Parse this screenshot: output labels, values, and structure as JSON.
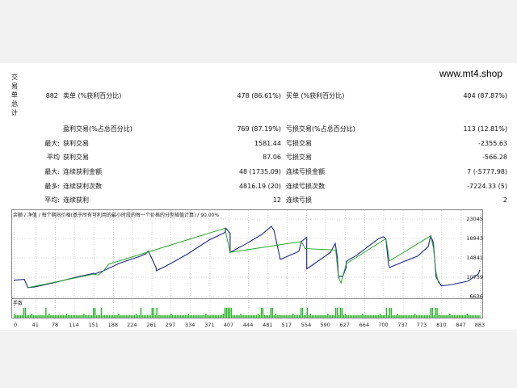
{
  "site": "www.mt4.shop",
  "side_label": [
    "交",
    "易",
    "单",
    "总",
    "计"
  ],
  "stats": {
    "total": "882",
    "short_label": "卖单 (%获利百分比)",
    "short_value": "478 (86.61%)",
    "long_label": "买单 (%获利百分比)",
    "long_value": "404 (87.87%)",
    "profit_trades_label": "盈利交易(%占总百分比)",
    "profit_trades_value": "769 (87.19%)",
    "loss_trades_label": "亏损交易(%占总百分比)",
    "loss_trades_value": "113 (12.81%)",
    "max_label": "最大:",
    "max_profit_label": "获利交易",
    "max_profit_value": "1581.44",
    "max_loss_label": "亏损交易",
    "max_loss_value": "-2355.63",
    "avg_label": "平均",
    "avg_profit_label": "获利交易",
    "avg_profit_value": "87.06",
    "avg_loss_label": "亏损交易",
    "avg_loss_value": "-566.28",
    "max2_label": "最大:",
    "cons_win_amt_label": "连续获利金额",
    "cons_win_amt_value": "48 (1735.09)",
    "cons_loss_amt_label": "连续亏损金额",
    "cons_loss_amt_value": "7 (-5777.98)",
    "most_label": "最多:",
    "cons_win_cnt_label": "连续获利次数",
    "cons_win_cnt_value": "4816.19 (20)",
    "cons_loss_cnt_label": "连续亏损次数",
    "cons_loss_cnt_value": "-7224.33 (5)",
    "avg2_label": "平均:",
    "avg_cons_win_label": "连续获利",
    "avg_cons_win_value": "12",
    "avg_cons_loss_label": "连续亏损",
    "avg_cons_loss_value": "2"
  },
  "chart_data": {
    "type": "line",
    "legend": "余额 / 净值 / 每个期间价格(基于所有可利用的最小时段的每一个价格的分型插值计算) / 90.00%",
    "volume_label": "手数",
    "yticks": [
      23045,
      18943,
      14841,
      10739,
      6636
    ],
    "ylim": [
      6636,
      23045
    ],
    "xticks": [
      0,
      41,
      78,
      114,
      151,
      188,
      224,
      261,
      297,
      334,
      371,
      407,
      444,
      481,
      517,
      554,
      590,
      627,
      664,
      700,
      737,
      773,
      810,
      847,
      883
    ],
    "xlim": [
      0,
      883
    ],
    "colors": {
      "balance": "#1a2a8c",
      "equity": "#1ba21b",
      "volume": "#2bb52b",
      "grid": "#b4b4b4"
    },
    "series": [
      {
        "name": "余额",
        "x": [
          0,
          20,
          27,
          40,
          80,
          120,
          152,
          152,
          170,
          200,
          240,
          250,
          255,
          270,
          270,
          290,
          330,
          370,
          400,
          402,
          410,
          410,
          440,
          470,
          488,
          493,
          505,
          540,
          545,
          555,
          555,
          600,
          609,
          613,
          615,
          620,
          623,
          630,
          630,
          650,
          690,
          700,
          705,
          710,
          712,
          740,
          765,
          785,
          790,
          795,
          800,
          810,
          830,
          860,
          880,
          883
        ],
        "y": [
          10100,
          10300,
          8550,
          8700,
          9700,
          10800,
          11600,
          11400,
          12100,
          13700,
          15200,
          15700,
          16300,
          12700,
          12100,
          13200,
          15700,
          18600,
          20200,
          21100,
          20000,
          16000,
          17800,
          19800,
          21500,
          20600,
          14500,
          16200,
          18300,
          19200,
          12500,
          16000,
          17900,
          15000,
          10800,
          11000,
          10800,
          12900,
          14100,
          15400,
          18800,
          19300,
          18900,
          13400,
          12800,
          14100,
          15200,
          17200,
          19500,
          18000,
          10800,
          8900,
          9200,
          9900,
          11400,
          12300
        ]
      },
      {
        "name": "净值",
        "x": [
          27,
          152,
          160,
          170,
          180,
          400,
          405,
          410,
          545,
          552,
          610,
          615,
          620,
          630,
          705,
          712,
          790,
          795,
          800,
          805
        ],
        "y": [
          8550,
          11400,
          11200,
          12100,
          13500,
          21100,
          18500,
          16000,
          18300,
          16800,
          16500,
          10900,
          9500,
          13600,
          18900,
          14200,
          19500,
          17000,
          11800,
          9400
        ]
      }
    ]
  }
}
